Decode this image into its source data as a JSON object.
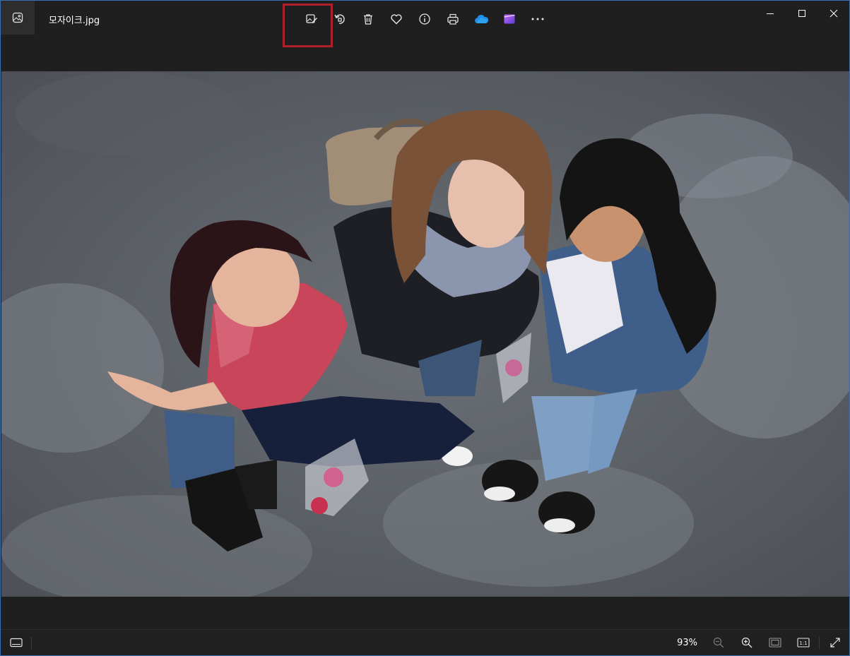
{
  "window": {
    "file_name": "모자이크.jpg"
  },
  "toolbar": {
    "buttons": [
      {
        "name": "edit-image-button",
        "icon": "edit-image-icon"
      },
      {
        "name": "rotate-button",
        "icon": "rotate-icon"
      },
      {
        "name": "delete-button",
        "icon": "trash-icon"
      },
      {
        "name": "favorite-button",
        "icon": "heart-icon"
      },
      {
        "name": "info-button",
        "icon": "info-icon"
      },
      {
        "name": "print-button",
        "icon": "printer-icon"
      },
      {
        "name": "onedrive-button",
        "icon": "onedrive-cloud-icon"
      },
      {
        "name": "clipchamp-button",
        "icon": "video-editor-icon"
      },
      {
        "name": "more-options-button",
        "icon": "ellipsis-icon"
      }
    ],
    "highlighted_button": "edit-image-button",
    "highlight_color": "#b0202c"
  },
  "window_controls": [
    "minimize-icon",
    "maximize-icon",
    "close-icon"
  ],
  "bottom_bar": {
    "zoom_level": "93%",
    "buttons": [
      "zoom-out-icon",
      "zoom-in-icon",
      "fit-to-window-icon",
      "actual-size-icon",
      "fullscreen-icon"
    ]
  },
  "colors": {
    "background": "#1f1f1f",
    "onedrive_blue": "#1f8fe8",
    "clipchamp_purple": "#8a4bd8"
  }
}
